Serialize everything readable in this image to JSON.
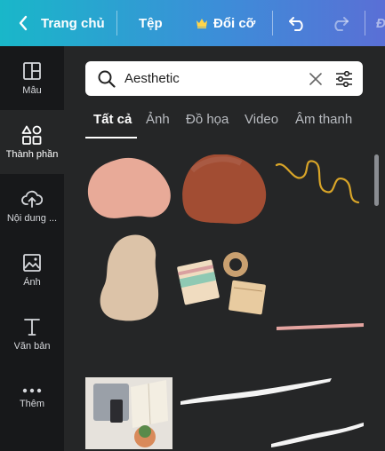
{
  "topbar": {
    "home_label": "Trang chủ",
    "file_label": "Tệp",
    "resize_label": "Đổi cỡ",
    "cut_label": "Đ"
  },
  "sidebar": {
    "items": [
      {
        "label": "Mẫu",
        "icon": "template-icon"
      },
      {
        "label": "Thành phần",
        "icon": "elements-icon"
      },
      {
        "label": "Nội dung ...",
        "icon": "upload-icon"
      },
      {
        "label": "Ảnh",
        "icon": "photo-icon"
      },
      {
        "label": "Văn bản",
        "icon": "text-icon"
      },
      {
        "label": "Thêm",
        "icon": "more-icon"
      }
    ]
  },
  "search": {
    "value": "Aesthetic"
  },
  "tabs": [
    {
      "label": "Tất cả"
    },
    {
      "label": "Ảnh"
    },
    {
      "label": "Đồ họa"
    },
    {
      "label": "Video"
    },
    {
      "label": "Âm thanh"
    }
  ],
  "colors": {
    "accent_start": "#19b7c9",
    "accent_end": "#5a6fd6",
    "panel_bg": "#252627",
    "sidebar_bg": "#17181a",
    "blob_pink": "#e8aa98",
    "blob_brown": "#a24d33",
    "blob_beige": "#dcc3a8",
    "squiggle_gold": "#d9a528"
  }
}
